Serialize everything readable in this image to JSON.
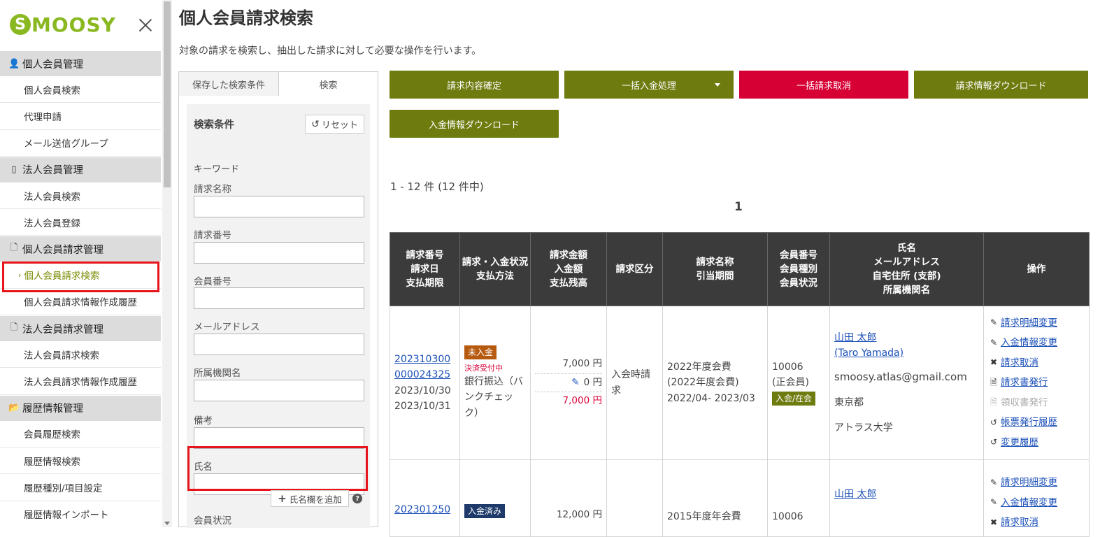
{
  "app": {
    "logo_text": "MOOSY",
    "logo_initial": "S"
  },
  "sidebar": {
    "sections": [
      {
        "icon": "person-icon",
        "glyph": "👤",
        "title": "個人会員管理",
        "items": [
          "個人会員検索",
          "代理申請",
          "メール送信グループ"
        ]
      },
      {
        "icon": "building-icon",
        "glyph": "▯",
        "title": "法人会員管理",
        "items": [
          "法人会員検索",
          "法人会員登録"
        ]
      },
      {
        "icon": "document-icon",
        "glyph": "🗋",
        "title": "個人会員請求管理",
        "items": [
          "個人会員請求検索",
          "個人会員請求情報作成履歴"
        ]
      },
      {
        "icon": "document-icon",
        "glyph": "🗋",
        "title": "法人会員請求管理",
        "items": [
          "法人会員請求検索",
          "法人会員請求情報作成履歴"
        ]
      },
      {
        "icon": "folder-icon",
        "glyph": "📂",
        "title": "履歴情報管理",
        "items": [
          "会員履歴検索",
          "履歴情報検索",
          "履歴種別/項目設定",
          "履歴情報インポート"
        ]
      }
    ],
    "active_item": "個人会員請求検索"
  },
  "page": {
    "title": "個人会員請求検索",
    "description": "対象の請求を検索し、抽出した請求に対して必要な操作を行います。"
  },
  "search": {
    "tab_saved": "保存した検索条件",
    "tab_search": "検索",
    "conditions_title": "検索条件",
    "reset_label": "リセット",
    "keyword_title": "キーワード",
    "fields": [
      {
        "label": "請求名称",
        "value": ""
      },
      {
        "label": "請求番号",
        "value": ""
      },
      {
        "label": "会員番号",
        "value": ""
      },
      {
        "label": "メールアドレス",
        "value": ""
      },
      {
        "label": "所属機関名",
        "value": ""
      },
      {
        "label": "備考",
        "value": ""
      },
      {
        "label": "氏名",
        "value": ""
      }
    ],
    "add_name_label": "氏名欄を追加",
    "member_status_label": "会員状況"
  },
  "actions": {
    "confirm": "請求内容確定",
    "bulk_payment": "一括入金処理",
    "bulk_cancel": "一括請求取消",
    "download_billing": "請求情報ダウンロード",
    "download_payment": "入金情報ダウンロード"
  },
  "results": {
    "count_text": "1 - 12 件 (12 件中)",
    "current_page": "1"
  },
  "table": {
    "headers": [
      [
        "請求番号",
        "請求日",
        "支払期限"
      ],
      [
        "請求・入金状況",
        "支払方法"
      ],
      [
        "請求金額",
        "入金額",
        "支払残高"
      ],
      [
        "請求区分"
      ],
      [
        "請求名称",
        "引当期間"
      ],
      [
        "会員番号",
        "会員種別",
        "会員状況"
      ],
      [
        "氏名",
        "メールアドレス",
        "自宅住所 (支部)",
        "所属機関名"
      ],
      [
        "操作"
      ]
    ],
    "rows": [
      {
        "bill_no_1": "202310300",
        "bill_no_2": "000024325",
        "bill_date": "2023/10/30",
        "due_date": "2023/10/31",
        "status": "未入金",
        "payment_note": "決済受付中",
        "method": "銀行振込（バンクチェック）",
        "amount": "7,000 円",
        "paid": "0 円",
        "balance": "7,000 円",
        "category": "入会時請求",
        "bill_name": "2022年度会費",
        "bill_name_sub": "(2022年度会費)",
        "period": "2022/04- 2023/03",
        "member_no": "10006",
        "member_type": "(正会員)",
        "member_status": "入会/在会",
        "name": "山田 太郎",
        "name_en": "(Taro Yamada)",
        "email": "smoosy.atlas@gmail.com",
        "address": "東京都",
        "org": "アトラス大学",
        "ops": [
          "請求明細変更",
          "入金情報変更",
          "請求取消",
          "請求書発行",
          "領収書発行",
          "帳票発行履歴",
          "変更履歴"
        ]
      },
      {
        "bill_no_1": "202301250",
        "status": "入金済み",
        "amount": "12,000 円",
        "bill_name": "2015年度年会費",
        "member_no": "10006",
        "name": "山田 太郎",
        "ops": [
          "請求明細変更",
          "入金情報変更",
          "請求取消"
        ]
      }
    ]
  },
  "colors": {
    "olive": "#6e7b0f",
    "red": "#d70035",
    "highlight": "#e8141c",
    "header_bg": "#3b3b3b",
    "logo_green": "#8ab821"
  }
}
